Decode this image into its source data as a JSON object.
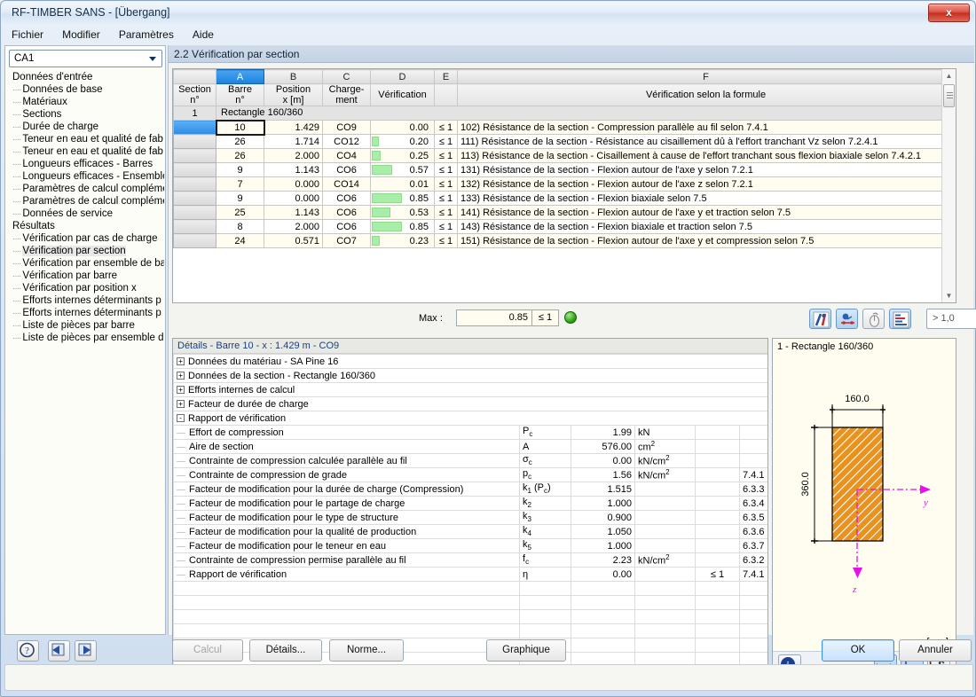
{
  "window": {
    "title": "RF-TIMBER SANS - [Übergang]",
    "close_label": "x"
  },
  "menubar": {
    "items": [
      "Fichier",
      "Modifier",
      "Paramètres",
      "Aide"
    ]
  },
  "sidebar": {
    "combo_value": "CA1",
    "tree": [
      {
        "label": "Données d'entrée",
        "type": "root"
      },
      {
        "label": "Données de base",
        "type": "leaf"
      },
      {
        "label": "Matériaux",
        "type": "leaf"
      },
      {
        "label": "Sections",
        "type": "leaf"
      },
      {
        "label": "Durée de charge",
        "type": "leaf"
      },
      {
        "label": "Teneur en eau et qualité de fab",
        "type": "leaf"
      },
      {
        "label": "Teneur en eau et qualité de fab",
        "type": "leaf"
      },
      {
        "label": "Longueurs efficaces - Barres",
        "type": "leaf"
      },
      {
        "label": "Longueurs efficaces - Ensemble",
        "type": "leaf"
      },
      {
        "label": "Paramètres de calcul compléme",
        "type": "leaf"
      },
      {
        "label": "Paramètres de calcul compléme",
        "type": "leaf"
      },
      {
        "label": "Données de service",
        "type": "leaf"
      },
      {
        "label": "Résultats",
        "type": "root"
      },
      {
        "label": "Vérification par cas de charge",
        "type": "leaf"
      },
      {
        "label": "Vérification par section",
        "type": "leaf",
        "selected": true
      },
      {
        "label": "Vérification par ensemble de ba",
        "type": "leaf"
      },
      {
        "label": "Vérification par barre",
        "type": "leaf"
      },
      {
        "label": "Vérification par position x",
        "type": "leaf"
      },
      {
        "label": "Efforts internes déterminants p",
        "type": "leaf"
      },
      {
        "label": "Efforts internes déterminants p",
        "type": "leaf"
      },
      {
        "label": "Liste de pièces par barre",
        "type": "leaf"
      },
      {
        "label": "Liste de pièces par ensemble d",
        "type": "leaf"
      }
    ]
  },
  "main": {
    "header": "2.2  Vérification par section",
    "table": {
      "column_letters": [
        "A",
        "B",
        "C",
        "D",
        "E",
        "F"
      ],
      "selected_column": "A",
      "headers": [
        "Section\nn°",
        "Barre\nn°",
        "Position\nx [m]",
        "Charge-\nment",
        "Vérification",
        "",
        "Vérification selon la formule"
      ],
      "header_parts": {
        "section": [
          "Section",
          "n°"
        ],
        "barre": [
          "Barre",
          "n°"
        ],
        "position": [
          "Position",
          "x [m]"
        ],
        "chargement": [
          "Charge-",
          "ment"
        ],
        "verification": "Vérification",
        "formule": "Vérification selon la formule"
      },
      "section_row": {
        "num": "1",
        "name": "Rectangle 160/360"
      },
      "rows": [
        {
          "barre": "10",
          "position": "1.429",
          "chargement": "CO9",
          "verification": "0.00",
          "bar_pct": 0,
          "cond": "≤ 1",
          "formule": "102) Résistance de la section - Compression parallèle au fil selon 7.4.1",
          "selected": true
        },
        {
          "barre": "26",
          "position": "1.714",
          "chargement": "CO12",
          "verification": "0.20",
          "bar_pct": 20,
          "cond": "≤ 1",
          "formule": "111) Résistance de la section - Résistance au cisaillement dû à l'effort tranchant Vz selon 7.2.4.1"
        },
        {
          "barre": "26",
          "position": "2.000",
          "chargement": "CO4",
          "verification": "0.25",
          "bar_pct": 25,
          "cond": "≤ 1",
          "formule": "113) Résistance de la section - Cisaillement à cause de l'effort tranchant sous flexion biaxiale selon 7.4.2.1"
        },
        {
          "barre": "9",
          "position": "1.143",
          "chargement": "CO6",
          "verification": "0.57",
          "bar_pct": 57,
          "cond": "≤ 1",
          "formule": "131) Résistance de la section - Flexion autour de l'axe y selon 7.2.1"
        },
        {
          "barre": "7",
          "position": "0.000",
          "chargement": "CO14",
          "verification": "0.01",
          "bar_pct": 1,
          "cond": "≤ 1",
          "formule": "132) Résistance de la section - Flexion autour de l'axe z selon 7.2.1"
        },
        {
          "barre": "9",
          "position": "0.000",
          "chargement": "CO6",
          "verification": "0.85",
          "bar_pct": 85,
          "cond": "≤ 1",
          "formule": "133) Résistance de la section - Flexion biaxiale selon 7.5"
        },
        {
          "barre": "25",
          "position": "1.143",
          "chargement": "CO6",
          "verification": "0.53",
          "bar_pct": 53,
          "cond": "≤ 1",
          "formule": "141) Résistance de la section - Flexion autour de l'axe y et traction selon 7.5"
        },
        {
          "barre": "8",
          "position": "2.000",
          "chargement": "CO6",
          "verification": "0.85",
          "bar_pct": 85,
          "cond": "≤ 1",
          "formule": "143) Résistance de la section - Flexion biaxiale et traction selon 7.5"
        },
        {
          "barre": "24",
          "position": "0.571",
          "chargement": "CO7",
          "verification": "0.23",
          "bar_pct": 23,
          "cond": "≤ 1",
          "formule": "151) Résistance de la section - Flexion autour de l'axe y et compression selon 7.5"
        }
      ]
    },
    "maxbar": {
      "label": "Max :",
      "value": "0.85",
      "condition": "≤ 1",
      "filter_value": "> 1,0",
      "buttons": [
        {
          "name": "result-diagram-button",
          "state": "on"
        },
        {
          "name": "result-values-button",
          "state": "on"
        },
        {
          "name": "result-mouse-button",
          "state": "flat"
        },
        {
          "name": "result-table-button",
          "state": "on"
        },
        {
          "name": "filter-gt1-button",
          "state": "flat"
        },
        {
          "name": "print-report-button",
          "state": "flat"
        },
        {
          "name": "export-excel-button",
          "state": "flat"
        },
        {
          "name": "select-object-button",
          "state": "flat"
        },
        {
          "name": "view-mode-button",
          "state": "flat"
        }
      ]
    }
  },
  "details": {
    "title": "Détails - Barre 10 - x : 1.429 m - CO9",
    "groups": [
      {
        "expander": "+",
        "label": "Données du matériau - SA Pine 16"
      },
      {
        "expander": "+",
        "label": "Données de la section - Rectangle 160/360"
      },
      {
        "expander": "+",
        "label": "Efforts internes de calcul"
      },
      {
        "expander": "+",
        "label": "Facteur de durée de charge"
      },
      {
        "expander": "-",
        "label": "Rapport de vérification"
      }
    ],
    "rows": [
      {
        "label": "Effort de compression",
        "sym": "P",
        "sub": "c",
        "value": "1.99",
        "unit": "kN",
        "unit_sup": "",
        "cond": "",
        "ref": ""
      },
      {
        "label": "Aire de section",
        "sym": "A",
        "sub": "",
        "value": "576.00",
        "unit": "cm",
        "unit_sup": "2",
        "cond": "",
        "ref": ""
      },
      {
        "label": "Contrainte de compression calculée parallèle au fil",
        "sym": "σ",
        "sub": "c",
        "value": "0.00",
        "unit": "kN/cm",
        "unit_sup": "2",
        "cond": "",
        "ref": ""
      },
      {
        "label": "Contrainte de compression de grade",
        "sym": "p",
        "sub": "c",
        "value": "1.56",
        "unit": "kN/cm",
        "unit_sup": "2",
        "cond": "",
        "ref": "7.4.1"
      },
      {
        "label": "Facteur de modification pour la durée de charge (Compression)",
        "sym": "k",
        "sub": "1",
        "sym_extra": " (P",
        "sym_extra_sub": "c",
        "sym_extra_end": ")",
        "value": "1.515",
        "unit": "",
        "unit_sup": "",
        "cond": "",
        "ref": "6.3.3"
      },
      {
        "label": "Facteur de modification pour le partage de charge",
        "sym": "k",
        "sub": "2",
        "value": "1.000",
        "unit": "",
        "unit_sup": "",
        "cond": "",
        "ref": "6.3.4"
      },
      {
        "label": "Facteur de modification pour le type de structure",
        "sym": "k",
        "sub": "3",
        "value": "0.900",
        "unit": "",
        "unit_sup": "",
        "cond": "",
        "ref": "6.3.5"
      },
      {
        "label": "Facteur de modification pour la qualité de production",
        "sym": "k",
        "sub": "4",
        "value": "1.050",
        "unit": "",
        "unit_sup": "",
        "cond": "",
        "ref": "6.3.6"
      },
      {
        "label": "Facteur de modification pour le teneur en eau",
        "sym": "k",
        "sub": "5",
        "value": "1.000",
        "unit": "",
        "unit_sup": "",
        "cond": "",
        "ref": "6.3.7"
      },
      {
        "label": "Contrainte de compression permise parallèle au fil",
        "sym": "f",
        "sub": "c",
        "value": "2.23",
        "unit": "kN/cm",
        "unit_sup": "2",
        "cond": "",
        "ref": "6.3.2"
      },
      {
        "label": "Rapport de vérification",
        "sym": "η",
        "sub": "",
        "value": "0.00",
        "unit": "",
        "unit_sup": "",
        "cond": "≤ 1",
        "ref": "7.4.1"
      }
    ]
  },
  "graphic": {
    "title": "1 - Rectangle 160/360",
    "width_label": "160.0",
    "height_label": "360.0",
    "axis_y": "y",
    "axis_z": "z",
    "unit": "[mm]",
    "section_color": "#e8921f",
    "buttons": [
      {
        "name": "info-button"
      },
      {
        "name": "dimension-x-button",
        "state": "on"
      },
      {
        "name": "dimension-axes-button",
        "state": "on"
      },
      {
        "name": "zoom-reset-button",
        "state": "flat"
      }
    ]
  },
  "bottombar": {
    "help_button": "?",
    "prev_button": "◀",
    "next_button": "▶",
    "calcul": "Calcul",
    "details": "Détails...",
    "norme": "Norme...",
    "graphique": "Graphique",
    "ok": "OK",
    "annuler": "Annuler"
  },
  "scrollbars": {
    "left_tree_hscroll": "llll"
  }
}
